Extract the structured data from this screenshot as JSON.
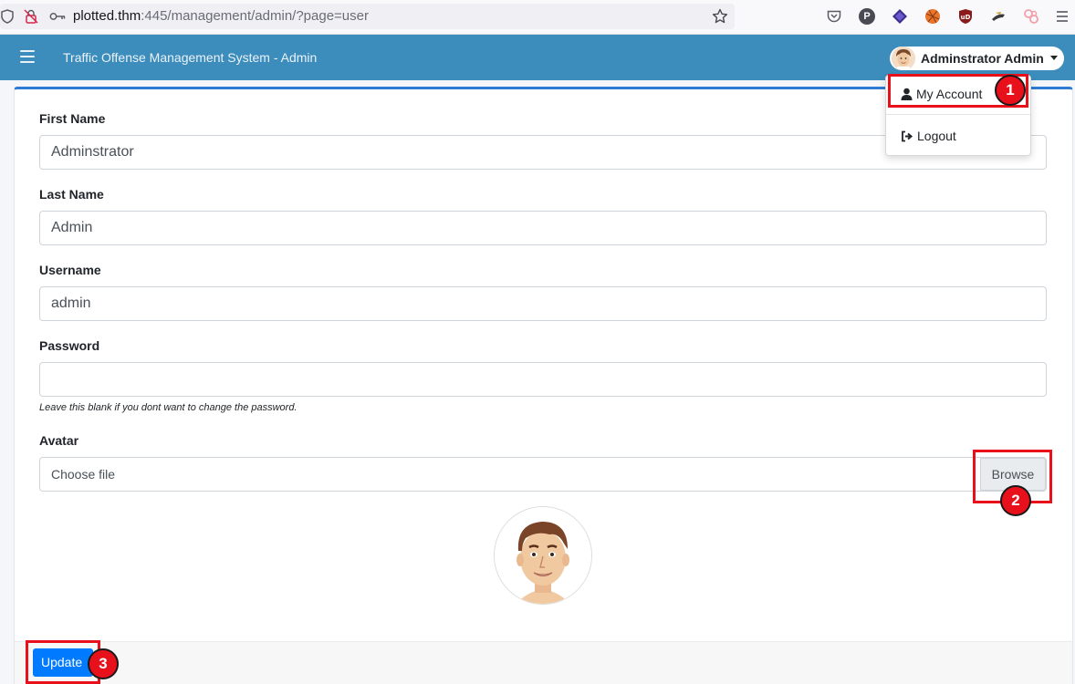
{
  "browser": {
    "url_host": "plotted.thm",
    "url_rest": ":445/management/admin/?page=user",
    "icons": [
      "shield-icon",
      "insecure-lock-icon",
      "key-icon",
      "star-icon",
      "pocket-icon",
      "profile-p-icon",
      "extension-diamond-icon",
      "extension-ball-icon",
      "ublock-icon",
      "extension-hat-icon",
      "extension-link-icon",
      "menu-icon"
    ],
    "profile_letter": "P",
    "ublock_text": "uD"
  },
  "header": {
    "title": "Traffic Offense Management System - Admin",
    "user_name": "Adminstrator Admin",
    "color": "#3c8dbc"
  },
  "dropdown": {
    "my_account": "My Account",
    "logout": "Logout"
  },
  "form": {
    "first_name_label": "First Name",
    "first_name_value": "Adminstrator",
    "last_name_label": "Last Name",
    "last_name_value": "Admin",
    "username_label": "Username",
    "username_value": "admin",
    "password_label": "Password",
    "password_value": "",
    "password_help": "Leave this blank if you dont want to change the password.",
    "avatar_label": "Avatar",
    "file_placeholder": "Choose file",
    "browse_label": "Browse",
    "update_label": "Update"
  },
  "annotations": {
    "badge_1": "1",
    "badge_2": "2",
    "badge_3": "3",
    "color": "#e8101a"
  }
}
